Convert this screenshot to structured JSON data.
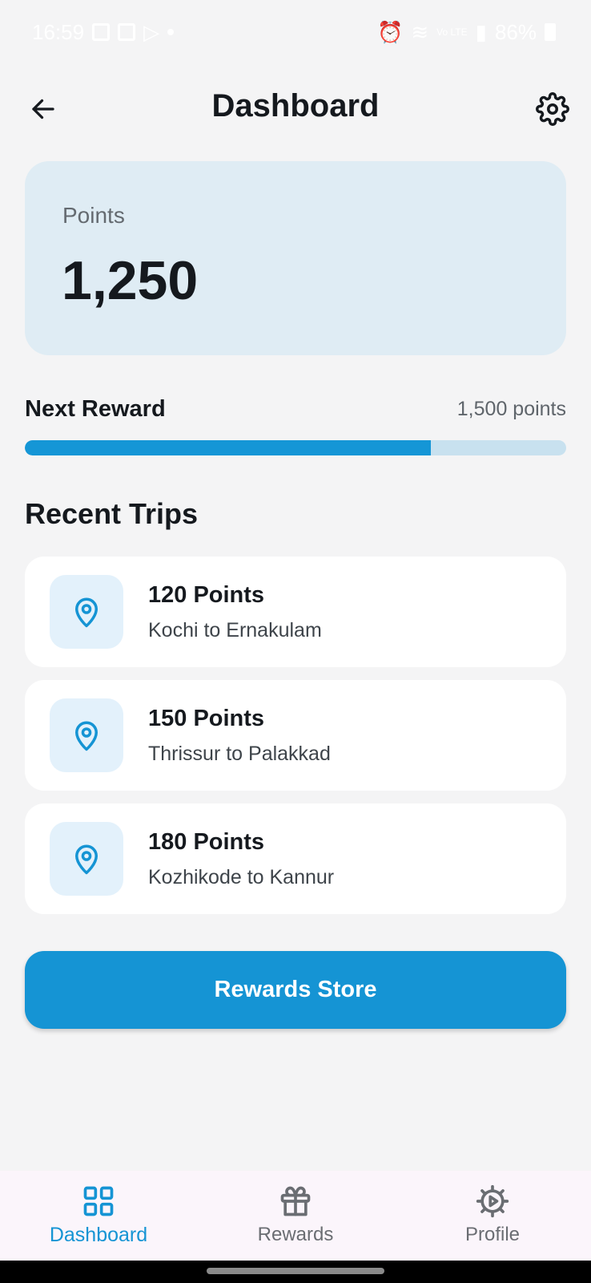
{
  "status_bar": {
    "time": "16:59",
    "battery": "86%",
    "network": "Vo LTE"
  },
  "header": {
    "title": "Dashboard",
    "back_icon": "arrow-left-icon",
    "settings_icon": "gear-icon"
  },
  "points_card": {
    "label": "Points",
    "value": "1,250"
  },
  "next_reward": {
    "label": "Next Reward",
    "target": "1,500 points",
    "progress_fraction": 0.75
  },
  "recent_trips": {
    "title": "Recent Trips",
    "items": [
      {
        "points": "120 Points",
        "route": "Kochi to Ernakulam",
        "icon": "map-pin-icon"
      },
      {
        "points": "150 Points",
        "route": "Thrissur to Palakkad",
        "icon": "map-pin-icon"
      },
      {
        "points": "180 Points",
        "route": "Kozhikode to Kannur",
        "icon": "map-pin-icon"
      }
    ]
  },
  "store_button": {
    "label": "Rewards Store"
  },
  "bottom_nav": {
    "items": [
      {
        "label": "Dashboard",
        "icon": "grid-icon",
        "active": true
      },
      {
        "label": "Rewards",
        "icon": "gift-icon",
        "active": false
      },
      {
        "label": "Profile",
        "icon": "gear-play-icon",
        "active": false
      }
    ]
  },
  "colors": {
    "accent": "#1594d4",
    "card_bg": "#dfecf4",
    "progress_track": "#c8e1ef",
    "page_bg": "#f4f4f5"
  }
}
